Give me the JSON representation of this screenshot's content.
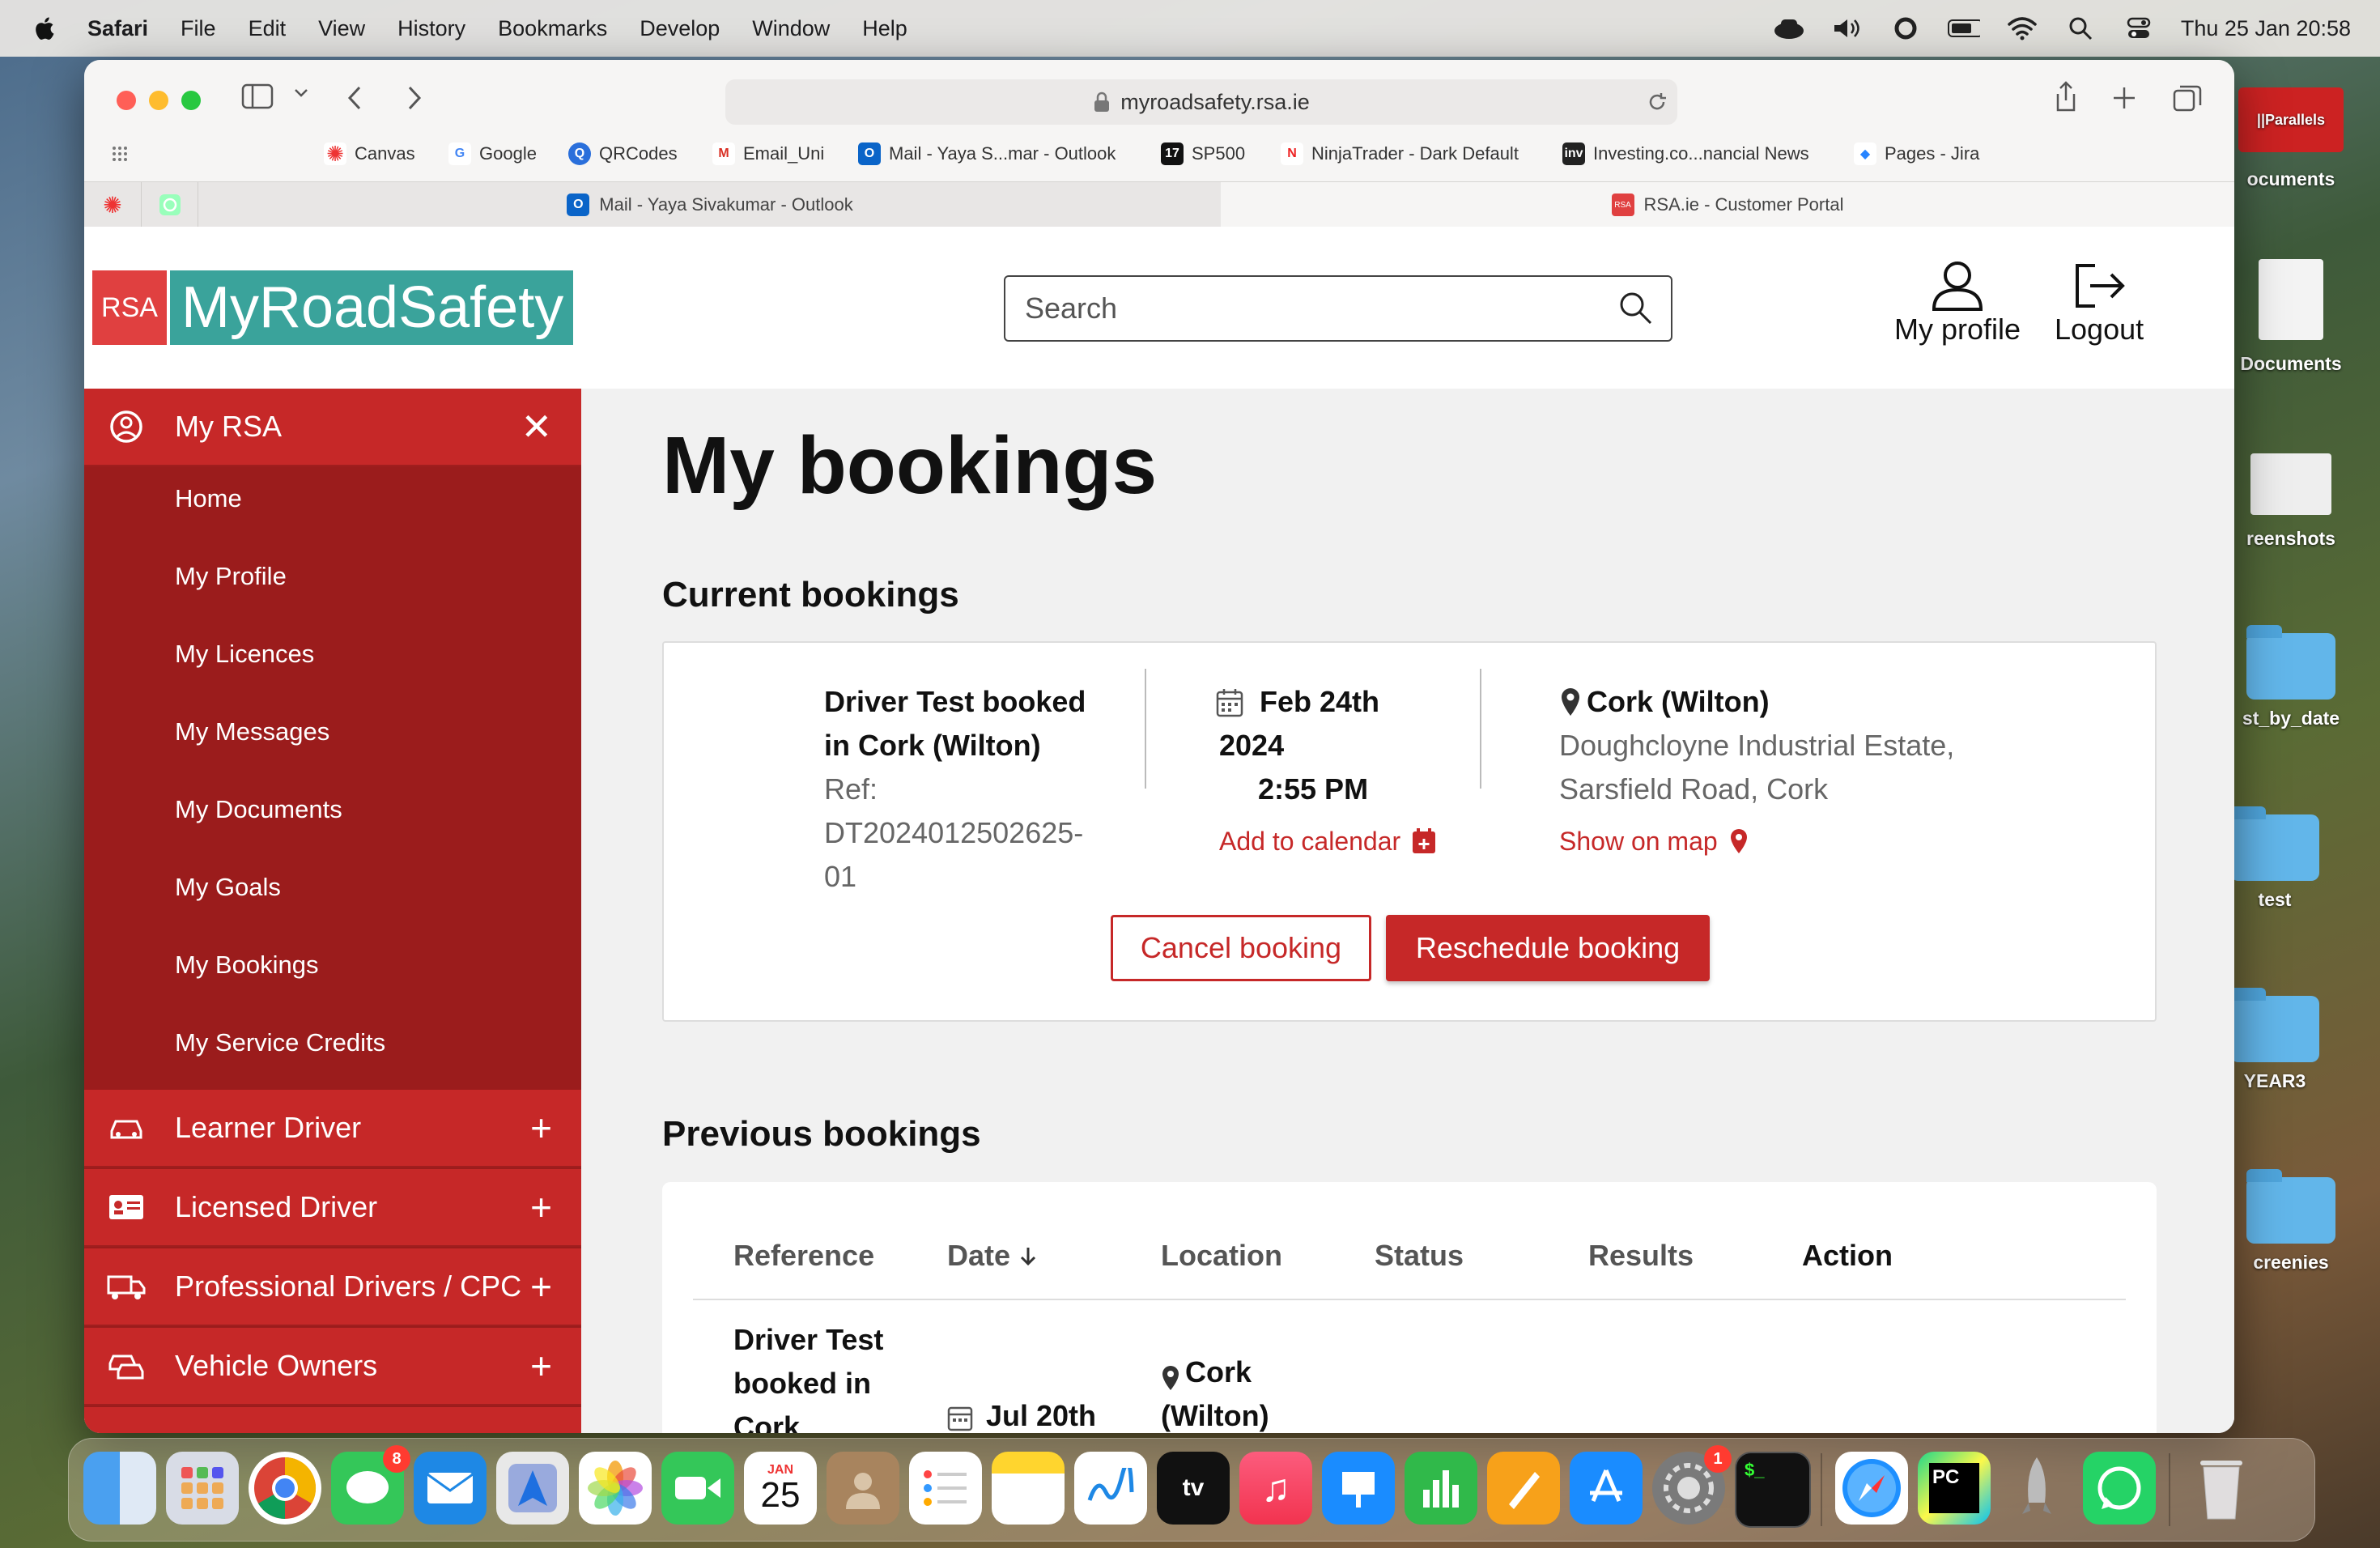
{
  "menubar": {
    "app": "Safari",
    "items": [
      "File",
      "Edit",
      "View",
      "History",
      "Bookmarks",
      "Develop",
      "Window",
      "Help"
    ],
    "clock": "Thu 25 Jan  20:58"
  },
  "desktop": {
    "icons": [
      "ocuments",
      "Documents",
      "reenshots",
      "st_by_date",
      "test",
      "YEAR3",
      "creenies"
    ],
    "parallels_label": "||Parallels"
  },
  "browser": {
    "url": "myroadsafety.rsa.ie",
    "favorites": [
      "Canvas",
      "Google",
      "QRCodes",
      "Email_Uni",
      "Mail - Yaya S...mar - Outlook",
      "SP500",
      "NinjaTrader - Dark Default",
      "Investing.co...nancial News",
      "Pages - Jira"
    ],
    "tabs": [
      "Mail - Yaya Sivakumar - Outlook",
      "RSA.ie - Customer Portal"
    ]
  },
  "header": {
    "logo_rsa": "RSA",
    "logo_text": "MyRoadSafety",
    "search_placeholder": "Search",
    "profile_label": "My profile",
    "logout_label": "Logout"
  },
  "sidebar": {
    "section": "My RSA",
    "items": [
      "Home",
      "My Profile",
      "My Licences",
      "My Messages",
      "My Documents",
      "My Goals",
      "My Bookings",
      "My Service Credits"
    ],
    "groups": [
      "Learner Driver",
      "Licensed Driver",
      "Professional Drivers / CPC",
      "Vehicle Owners"
    ]
  },
  "main": {
    "title": "My bookings",
    "current_heading": "Current bookings",
    "current": {
      "name_line1": "Driver Test booked",
      "name_line2": "in Cork (Wilton)",
      "ref_label": "Ref:",
      "ref_line1": "DT2024012502625-",
      "ref_line2": "01",
      "date_line1": "Feb 24th",
      "date_line2": "2024",
      "time": "2:55 PM",
      "add_calendar": "Add to calendar",
      "location_name": "Cork (Wilton)",
      "address_line1": "Doughcloyne Industrial Estate,",
      "address_line2": "Sarsfield Road, Cork",
      "show_map": "Show on map",
      "cancel": "Cancel booking",
      "reschedule": "Reschedule booking"
    },
    "previous_heading": "Previous bookings",
    "table": {
      "headers": [
        "Reference",
        "Date",
        "Location",
        "Status",
        "Results",
        "Action"
      ],
      "row": {
        "ref_line1": "Driver Test",
        "ref_line2": "booked in",
        "ref_line3": "Cork",
        "date": "Jul 20th",
        "loc_line1": "Cork",
        "loc_line2": "(Wilton)"
      }
    }
  },
  "dock": {
    "calendar_month": "JAN",
    "calendar_day": "25",
    "messages_badge": "8",
    "settings_badge": "1"
  },
  "colors": {
    "brand_red": "#c62828",
    "sidebar_dark": "#9b1c1c",
    "teal": "#3aa39b"
  }
}
